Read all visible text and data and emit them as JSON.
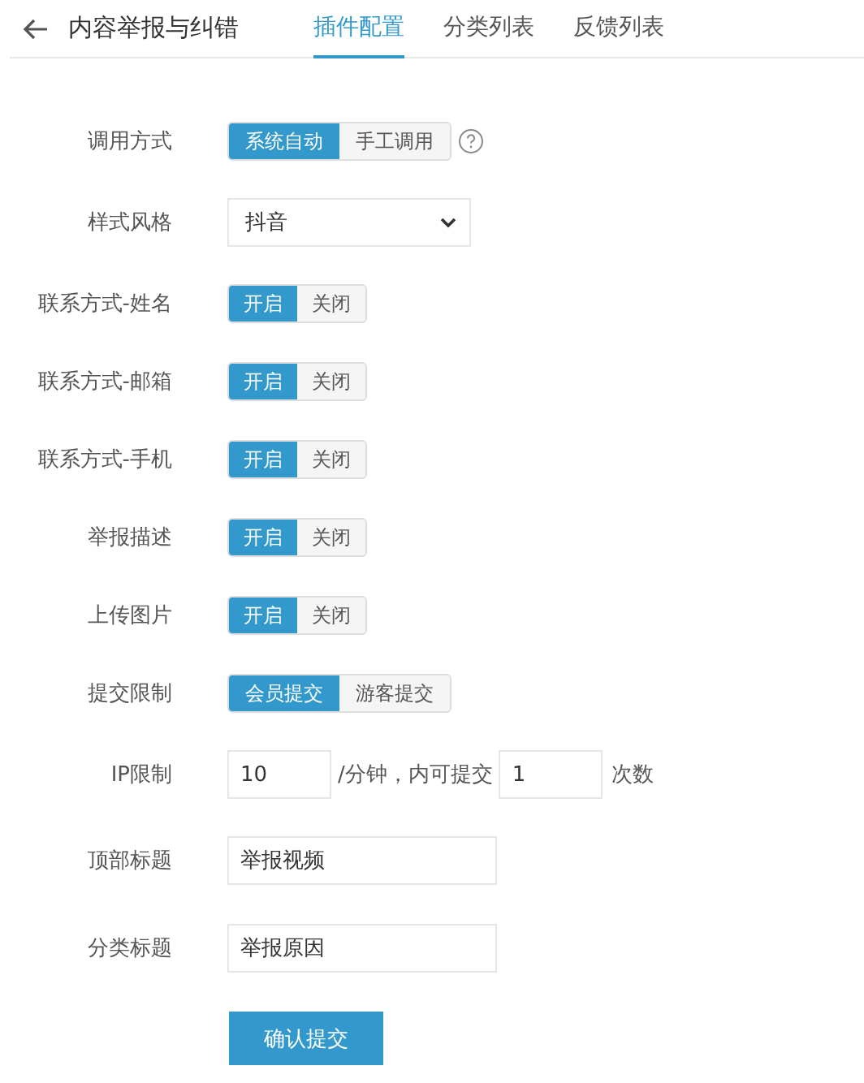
{
  "header": {
    "title": "内容举报与纠错"
  },
  "tabs": [
    {
      "label": "插件配置",
      "selected": true
    },
    {
      "label": "分类列表",
      "selected": false
    },
    {
      "label": "反馈列表",
      "selected": false
    }
  ],
  "fields": [
    {
      "kind": "segmented",
      "label": "调用方式",
      "help": true,
      "options": [
        {
          "label": "系统自动",
          "selected": true
        },
        {
          "label": "手工调用",
          "selected": false
        }
      ]
    },
    {
      "kind": "select",
      "label": "样式风格",
      "value": "抖音"
    },
    {
      "kind": "segmented",
      "label": "联系方式-姓名",
      "options": [
        {
          "label": "开启",
          "selected": true
        },
        {
          "label": "关闭",
          "selected": false
        }
      ]
    },
    {
      "kind": "segmented",
      "label": "联系方式-邮箱",
      "options": [
        {
          "label": "开启",
          "selected": true
        },
        {
          "label": "关闭",
          "selected": false
        }
      ]
    },
    {
      "kind": "segmented",
      "label": "联系方式-手机",
      "options": [
        {
          "label": "开启",
          "selected": true
        },
        {
          "label": "关闭",
          "selected": false
        }
      ]
    },
    {
      "kind": "segmented",
      "label": "举报描述",
      "options": [
        {
          "label": "开启",
          "selected": true
        },
        {
          "label": "关闭",
          "selected": false
        }
      ]
    },
    {
      "kind": "segmented",
      "label": "上传图片",
      "options": [
        {
          "label": "开启",
          "selected": true
        },
        {
          "label": "关闭",
          "selected": false
        }
      ]
    },
    {
      "kind": "segmented",
      "label": "提交限制",
      "options": [
        {
          "label": "会员提交",
          "selected": true
        },
        {
          "label": "游客提交",
          "selected": false
        }
      ]
    },
    {
      "kind": "rate",
      "label": "IP限制",
      "minutes": "10",
      "middle": "/分钟，内可提交",
      "count": "1",
      "unit": "次数"
    },
    {
      "kind": "text",
      "label": "顶部标题",
      "value": "举报视频"
    },
    {
      "kind": "text",
      "label": "分类标题",
      "value": "举报原因"
    }
  ],
  "submit": "确认提交"
}
